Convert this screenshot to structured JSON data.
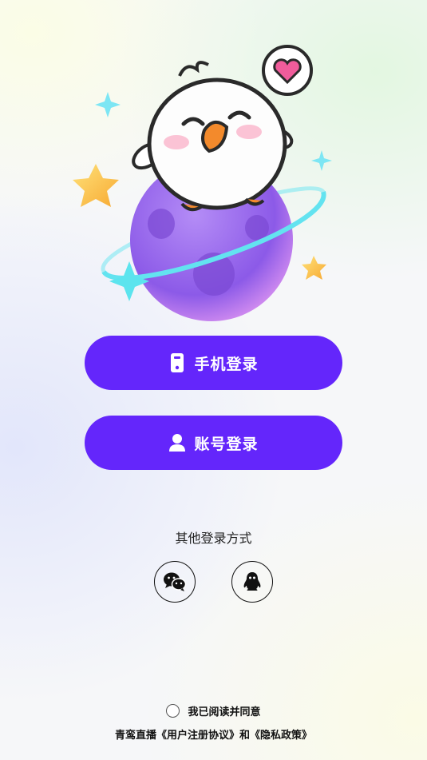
{
  "login": {
    "phone_label": "手机登录",
    "account_label": "账号登录",
    "other_methods_title": "其他登录方式",
    "social": [
      {
        "name": "wechat",
        "icon": "wechat-icon"
      },
      {
        "name": "qq",
        "icon": "qq-penguin-icon"
      }
    ]
  },
  "agreement": {
    "read_agree": "我已阅读并同意",
    "app_name": "青鸾直播",
    "user_agreement": "《用户注册协议》",
    "and": "和",
    "privacy_policy": "《隐私政策》",
    "checked": false
  },
  "colors": {
    "primary": "#6426fb",
    "planet": "#9b6cf0",
    "ring": "#63e3f0",
    "star": "#f9c441",
    "heart": "#f05c9b"
  }
}
